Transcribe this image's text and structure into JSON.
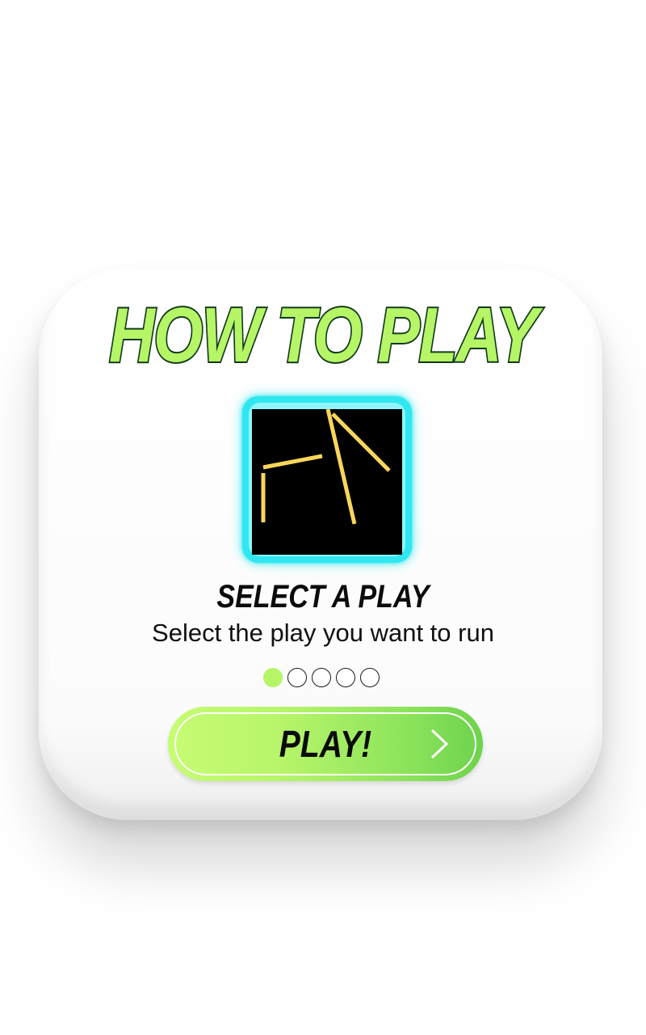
{
  "dialog": {
    "title": "HOW TO PLAY",
    "step_title": "SELECT A PLAY",
    "step_description": "Select the play you want to run",
    "preview_icon": "play-diagram",
    "pagination": {
      "current": 1,
      "total": 5
    },
    "play_button": {
      "label": "PLAY!",
      "icon": "chevron-right-icon"
    }
  },
  "colors": {
    "accent_green": "#b5f566",
    "title_outline": "#12391c",
    "preview_glow": "#30e7ef",
    "route_lines": "#f9d65a"
  }
}
